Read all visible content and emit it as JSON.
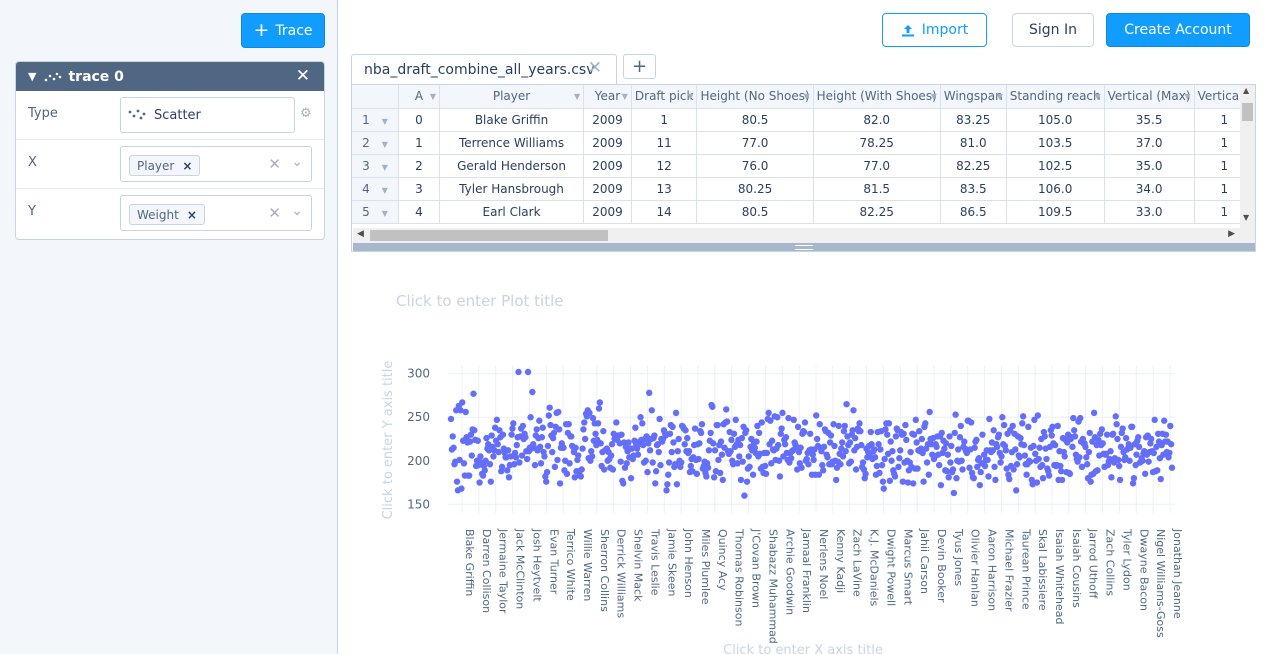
{
  "sidebar": {
    "add_trace_label": "Trace",
    "trace": {
      "name": "trace 0",
      "fields": {
        "type_label": "Type",
        "type_value": "Scatter",
        "x_label": "X",
        "x_value": "Player",
        "y_label": "Y",
        "y_value": "Weight"
      }
    }
  },
  "header": {
    "import_label": "Import",
    "signin_label": "Sign In",
    "create_label": "Create Account"
  },
  "grid": {
    "file_tab": "nba_draft_combine_all_years.csv",
    "columns": [
      "A",
      "Player",
      "Year",
      "Draft pick",
      "Height (No Shoes)",
      "Height (With Shoes)",
      "Wingspan",
      "Standing reach",
      "Vertical (Max)",
      "Vertical ("
    ],
    "rows": [
      {
        "n": "1",
        "cells": [
          "0",
          "Blake Griffin",
          "2009",
          "1",
          "80.5",
          "82.0",
          "83.25",
          "105.0",
          "35.5",
          "1"
        ]
      },
      {
        "n": "2",
        "cells": [
          "1",
          "Terrence Williams",
          "2009",
          "11",
          "77.0",
          "78.25",
          "81.0",
          "103.5",
          "37.0",
          "1"
        ]
      },
      {
        "n": "3",
        "cells": [
          "2",
          "Gerald Henderson",
          "2009",
          "12",
          "76.0",
          "77.0",
          "82.25",
          "102.5",
          "35.0",
          "1"
        ]
      },
      {
        "n": "4",
        "cells": [
          "3",
          "Tyler Hansbrough",
          "2009",
          "13",
          "80.25",
          "81.5",
          "83.5",
          "106.0",
          "34.0",
          "1"
        ]
      },
      {
        "n": "5",
        "cells": [
          "4",
          "Earl Clark",
          "2009",
          "14",
          "80.5",
          "82.25",
          "86.5",
          "109.5",
          "33.0",
          "1"
        ]
      }
    ]
  },
  "plot": {
    "title_placeholder": "Click to enter Plot title",
    "x_title_placeholder": "Click to enter X axis title",
    "y_title_placeholder": "Click to enter Y axis title"
  },
  "chart_data": {
    "type": "scatter",
    "title": "",
    "xlabel": "",
    "ylabel": "",
    "ylim": [
      140,
      310
    ],
    "yticks": [
      150,
      200,
      250,
      300
    ],
    "grid": true,
    "marker_color": "#636efa",
    "x_tick_labels": [
      "Blake Griffin",
      "Darren Collison",
      "Jermaine Taylor",
      "Jack McClinton",
      "Josh Heytvelt",
      "Evan Turner",
      "Terrico White",
      "Willie Warren",
      "Sherron Collins",
      "Derrick Williams",
      "Shelvin Mack",
      "Travis Leslie",
      "Jamie Skeen",
      "John Henson",
      "Miles Plumlee",
      "Quincy Acy",
      "Thomas Robinson",
      "J'Covan Brown",
      "Shabazz Muhammad",
      "Archie Goodwin",
      "Jamaal Franklin",
      "Nerlens Noel",
      "Kenny Kadji",
      "Zach LaVine",
      "K.J. McDaniels",
      "Dwight Powell",
      "Marcus Smart",
      "Jahii Carson",
      "Devin Booker",
      "Tyus Jones",
      "Olivier Hanlan",
      "Aaron Harrison",
      "Michael Frazier",
      "Taurean Prince",
      "Skal Labissiere",
      "Isaiah Whitehead",
      "Isaiah Cousins",
      "Jarrod Uthoff",
      "Zach Collins",
      "Tyler Lydon",
      "Dwayne Bacon",
      "Nigel Williams-Goss",
      "Jonathan Jeanne"
    ],
    "series": [
      {
        "values": [
          248,
          213,
          228,
          215,
          196,
          199,
          258,
          176,
          166,
          263,
          201,
          258,
          168,
          267,
          223,
          197,
          183,
          256,
          227,
          221,
          183,
          183,
          222,
          230,
          206,
          236,
          277,
          235,
          224,
          194,
          200,
          223,
          195,
          175,
          205,
          198,
          185,
          183,
          194,
          189,
          200,
          226,
          214,
          219,
          212,
          196,
          176,
          229,
          216,
          205,
          212,
          238,
          223,
          247,
          219,
          210,
          235,
          227,
          188,
          193,
          230,
          214,
          209,
          204,
          204,
          189,
          212,
          181,
          195,
          205,
          230,
          237,
          243,
          196,
          209,
          204,
          218,
          227,
          302,
          198,
          228,
          237,
          206,
          240,
          225,
          231,
          227,
          211,
          202,
          302,
          211,
          215,
          250,
          214,
          279,
          219,
          215,
          195,
          229,
          236,
          212,
          226,
          246,
          216,
          197,
          227,
          238,
          210,
          205,
          182,
          176,
          187,
          217,
          252,
          261,
          241,
          229,
          210,
          226,
          232,
          193,
          239,
          255,
          201,
          256,
          236,
          174,
          215,
          220,
          215,
          215,
          189,
          200,
          242,
          185,
          232,
          242,
          197,
          228,
          228,
          217,
          216,
          210,
          181,
          215,
          188,
          201,
          206,
          188,
          183,
          182,
          190,
          214,
          236,
          244,
          225,
          254,
          251,
          258,
          203,
          255,
          200,
          211,
          205,
          249,
          223,
          243,
          231,
          218,
          224,
          243,
          260,
          267,
          220,
          194,
          210,
          234,
          190,
          212,
          212,
          214,
          200,
          210,
          202,
          192,
          206,
          219,
          190,
          231,
          225,
          226,
          244,
          224,
          229,
          229,
          220,
          199,
          230,
          177,
          174,
          221,
          192,
          216,
          197,
          211,
          221,
          204,
          214,
          180,
          214,
          202,
          206,
          223,
          238,
          219,
          214,
          207,
          219,
          222,
          250,
          224,
          243,
          218,
          198,
          225,
          200,
          228,
          187,
          220,
          278,
          212,
          225,
          258,
          198,
          226,
          229,
          174,
          188,
          218,
          219,
          210,
          248,
          195,
          225,
          222,
          225,
          235,
          232,
          229,
          166,
          173,
          184,
          198,
          231,
          241,
          210,
          239,
          221,
          193,
          196,
          255,
          173,
          211,
          225,
          200,
          193,
          198,
          240,
          239,
          237,
          219,
          235,
          211,
          226,
          209,
          211,
          187,
          194,
          202,
          188,
          204,
          218,
          237,
          201,
          185,
          219,
          202,
          220,
          234,
          232,
          242,
          191,
          194,
          199,
          186,
          182,
          197,
          192,
          212,
          223,
          232,
          264,
          262,
          220,
          181,
          212,
          188,
          241,
          241,
          201,
          218,
          186,
          222,
          207,
          178,
          242,
          215,
          244,
          259,
          245,
          211,
          208,
          233,
          211,
          224,
          200,
          196,
          231,
          216,
          247,
          219,
          197,
          224,
          205,
          218,
          178,
          226,
          199,
          239,
          160,
          232,
          235,
          176,
          191,
          205,
          193,
          216,
          225,
          212,
          184,
          221,
          215,
          209,
          222,
          240,
          205,
          232,
          208,
          191,
          244,
          193,
          186,
          209,
          194,
          185,
          209,
          248,
          255,
          219,
          246,
          197,
          223,
          213,
          212,
          251,
          201,
          214,
          250,
          218,
          200,
          182,
          231,
          237,
          255,
          205,
          224,
          219,
          227,
          209,
          201,
          249,
          198,
          209,
          203,
          211,
          212,
          247,
          221,
          218,
          216,
          190,
          239,
          210,
          197,
          215,
          192,
          231,
          234,
          233,
          244,
          200,
          202,
          209,
          196,
          212,
          231,
          213,
          184,
          207,
          201,
          213,
          184,
          252,
          225,
          217,
          184,
          242,
          215,
          211,
          195,
          189,
          216,
          236,
          234,
          207,
          204,
          232,
          196,
          221,
          229,
          196,
          199,
          242,
          217,
          200,
          178,
          192,
          199,
          240,
          208,
          196,
          214,
          221,
          205,
          234,
          240,
          211,
          265,
          228,
          218,
          197,
          221,
          199,
          230,
          235,
          258,
          212,
          226,
          190,
          216,
          237,
          234,
          243,
          234,
          218,
          193,
          198,
          190,
          180,
          185,
          214,
          204,
          210,
          217,
          208,
          233,
          219,
          202,
          211,
          213,
          204,
          184,
          194,
          233,
          219,
          186,
          213,
          234,
          195,
          176,
          168,
          202,
          236,
          243,
          230,
          208,
          243,
          177,
          222,
          200,
          211,
          189,
          185,
          182,
          228,
          237,
          235,
          193,
          203,
          212,
          233,
          230,
          176,
          231,
          198,
          241,
          224,
          200,
          175,
          189,
          198,
          210,
          193,
          231,
          174,
          230,
          191,
          247,
          221,
          191,
          212,
          234,
          211,
          214,
          225,
          209,
          176,
          239,
          243,
          214,
          198,
          219,
          184,
          256,
          225,
          219,
          207,
          226,
          202,
          205,
          219,
          216,
          228,
          207,
          195,
          228,
          172,
          232,
          209,
          223,
          214,
          189,
          220,
          188,
          207,
          181,
          228,
          198,
          217,
          187,
          190,
          163,
          232,
          253,
          180,
          200,
          213,
          199,
          227,
          240,
          200,
          190,
          216,
          222,
          214,
          211,
          209,
          246,
          246,
          192,
          213,
          244,
          186,
          181,
          180,
          215,
          222,
          224,
          193,
          201,
          203,
          172,
          187,
          197,
          230,
          197,
          207,
          194,
          201,
          212,
          201,
          182,
          248,
          212,
          210,
          221,
          212,
          235,
          193,
          178,
          219,
          216,
          227,
          230,
          209,
          198,
          205,
          250,
          219,
          241,
          217,
          212,
          191,
          231,
          184,
          179,
          235,
          194,
          210,
          240,
          190,
          231,
          213,
          166,
          196,
          228,
          206,
          204,
          226,
          219,
          243,
          251,
          218,
          206,
          196,
          184,
          196,
          239,
          200,
          199,
          215,
          178,
          173,
          217,
          247,
          208,
          200,
          175,
          252,
          202,
          215,
          193,
          225,
          195,
          180,
          233,
          228,
          214,
          202,
          191,
          188,
          183,
          216,
          235,
          229,
          239,
          220,
          195,
          218,
          194,
          195,
          240,
          178,
          211,
          194,
          188,
          178,
          226,
          210,
          205,
          224,
          187,
          221,
          230,
          186,
          185,
          225,
          227,
          216,
          249,
          235,
          228,
          207,
          202,
          199,
          245,
          204,
          249,
          222,
          193,
          225,
          220,
          220,
          216,
          204,
          196,
          180,
          210,
          232,
          176,
          184,
          222,
          185,
          255,
          227,
          188,
          218,
          189,
          224,
          206,
          231,
          218,
          236,
          220,
          208,
          193,
          207,
          208,
          230,
          195,
          199,
          202,
          211,
          181,
          230,
          231,
          198,
          203,
          251,
          242,
          225,
          201,
          194,
          178,
          216,
          232,
          237,
          210,
          201,
          204,
          226,
          213,
          214,
          219,
          200,
          215,
          239,
          239,
          174,
          180,
          219,
          195,
          207,
          223,
          227,
          216,
          198,
          199,
          203,
          200,
          208,
          211,
          185,
          227,
          207,
          229,
          199,
          210,
          220,
          225,
          211,
          187,
          209,
          247,
          188,
          216,
          189,
          231,
          222,
          203,
          179,
          218,
          231,
          207,
          246,
          222,
          230,
          210,
          222,
          204,
          209,
          240,
          219,
          192
        ]
      }
    ]
  }
}
